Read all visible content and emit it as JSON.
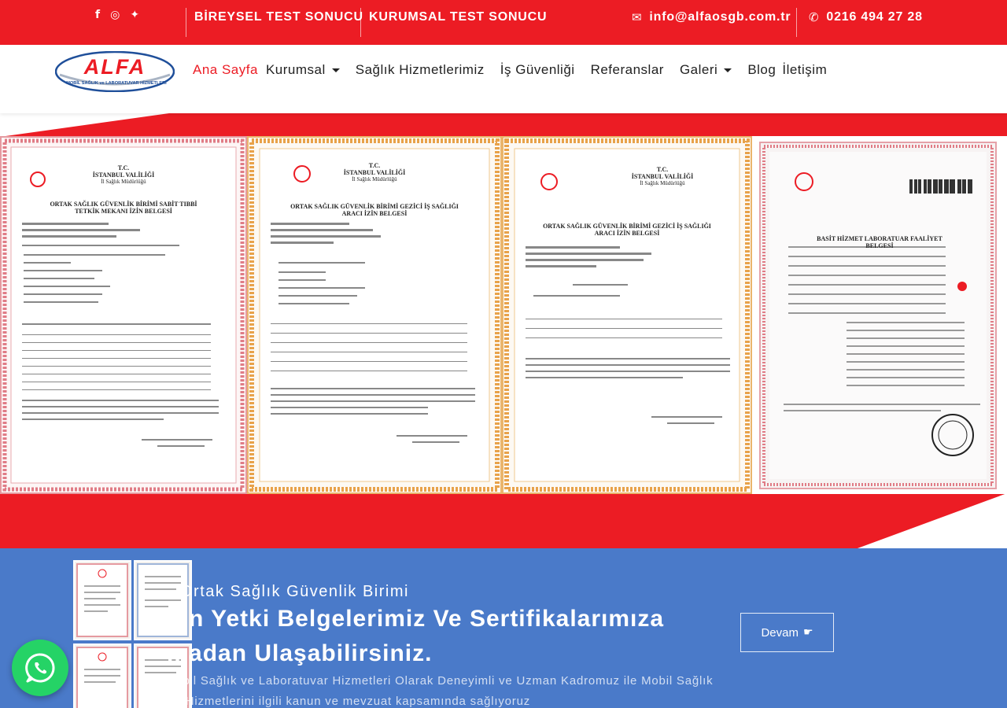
{
  "topbar": {
    "social_icons": [
      "facebook-icon",
      "instagram-icon",
      "twitter-icon"
    ],
    "social_glyphs": [
      "f",
      "◎",
      "✦"
    ],
    "links": [
      "BİREYSEL TEST SONUCU",
      "KURUMSAL TEST SONUCU"
    ],
    "email": "info@alfaosgb.com.tr",
    "phone": "0216 494 27 28",
    "email_glyph": "✉",
    "phone_glyph": "✆"
  },
  "logo": {
    "name": "ALFA",
    "tagline": "MOBİL SAĞLIK ve LABORATUVAR HİZMETLERİ"
  },
  "nav": {
    "items": [
      {
        "label": "Ana Sayfa",
        "active": true
      },
      {
        "label": "Kurumsal",
        "dropdown": true
      },
      {
        "label": "Sağlık Hizmetlerimiz"
      },
      {
        "label": "İş Güvenliği"
      },
      {
        "label": "Referanslar"
      },
      {
        "label": "Galeri",
        "dropdown": true
      },
      {
        "label": "Blog"
      },
      {
        "label": "İletişim"
      }
    ]
  },
  "certificates": [
    {
      "header": "T.C.",
      "org": "İSTANBUL VALİLİĞİ",
      "dept": "İl Sağlık Müdürlüğü",
      "title": "ORTAK SAĞLIK GÜVENLİK BİRİMİ SABİT TIBBİ TETKİK MEKANI İZİN BELGESİ"
    },
    {
      "header": "T.C.",
      "org": "İSTANBUL VALİLİĞİ",
      "dept": "İl Sağlık Müdürlüğü",
      "title": "ORTAK SAĞLIK GÜVENLİK BİRİMİ GEZİCİ İŞ SAĞLIĞI ARACI İZİN BELGESİ"
    },
    {
      "header": "T.C.",
      "org": "İSTANBUL VALİLİĞİ",
      "dept": "İl Sağlık Müdürlüğü",
      "title": "ORTAK SAĞLIK GÜVENLİK BİRİMİ GEZİCİ İŞ SAĞLIĞI ARACI İZİN BELGESİ"
    },
    {
      "header": "",
      "org": "",
      "dept": "",
      "title": "BASİT HİZMET LABORATUAR FAALİYET BELGESİ"
    }
  ],
  "promo": {
    "subtitle": "Ortak Sağlık Güvenlik Birimi",
    "headline": "...n Yetki Belgelerimiz Ve Sertifikalarımıza ...adan Ulaşabilirsiniz.",
    "paragraph": "Alfa Mobil Sağlık ve Laboratuvar Hizmetleri Olarak Deneyimli ve Uzman Kadromuz ile Mobil Sağlık Tarama Hizmetlerini ilgili kanun ve mevzuat kapsamında sağlıyoruz",
    "button": "Devam",
    "button_glyph": "☛"
  },
  "colors": {
    "brand_red": "#ec1c24",
    "promo_blue": "#4a7ac9",
    "whatsapp_green": "#25d366"
  }
}
